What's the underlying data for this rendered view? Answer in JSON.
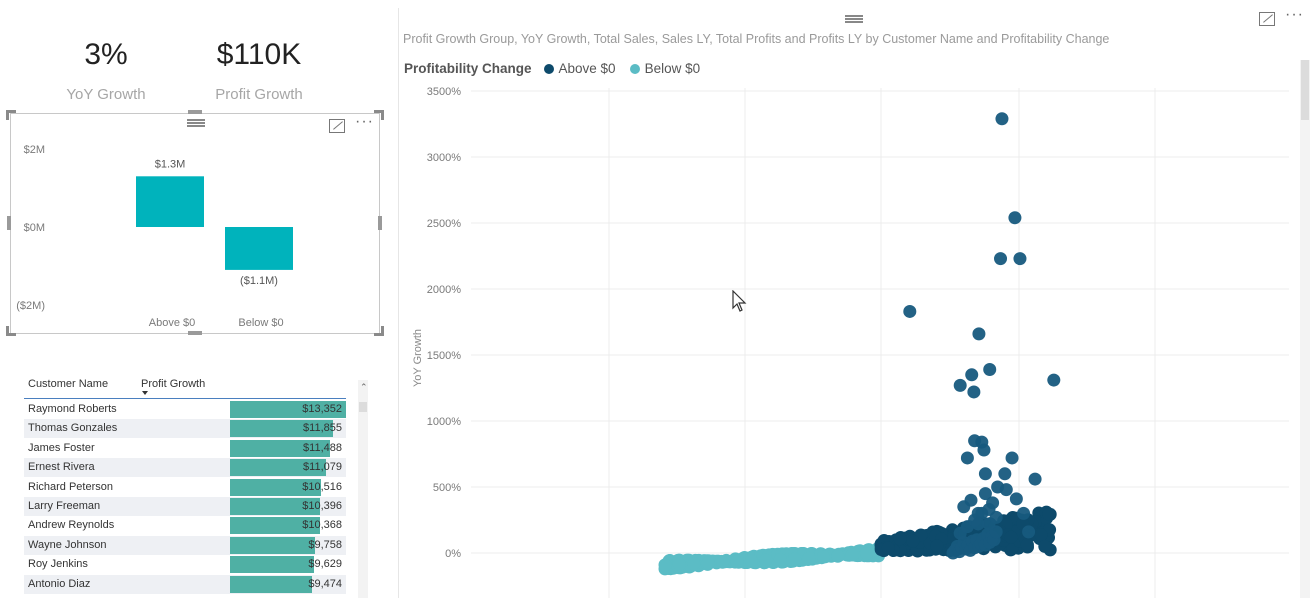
{
  "kpis": [
    {
      "value": "3%",
      "label": "YoY Growth"
    },
    {
      "value": "$110K",
      "label": "Profit Growth"
    }
  ],
  "bar_chart": {
    "y_ticks": [
      "$2M",
      "$0M",
      "($2M)"
    ],
    "categories": [
      "Above $0",
      "Below $0"
    ],
    "data_labels": [
      "$1.3M",
      "($1.1M)"
    ],
    "values": [
      1.3,
      -1.1
    ],
    "color": "#00b3bc"
  },
  "table": {
    "headers": [
      "Customer Name",
      "Profit Growth"
    ],
    "sort_icon": "sort-desc-icon",
    "bar_color": "#4fb0a4",
    "max": 13352,
    "rows": [
      {
        "name": "Raymond Roberts",
        "amount": "$13,352",
        "value": 13352
      },
      {
        "name": "Thomas Gonzales",
        "amount": "$11,855",
        "value": 11855
      },
      {
        "name": "James Foster",
        "amount": "$11,488",
        "value": 11488
      },
      {
        "name": "Ernest Rivera",
        "amount": "$11,079",
        "value": 11079
      },
      {
        "name": "Richard Peterson",
        "amount": "$10,516",
        "value": 10516
      },
      {
        "name": "Larry Freeman",
        "amount": "$10,396",
        "value": 10396
      },
      {
        "name": "Andrew Reynolds",
        "amount": "$10,368",
        "value": 10368
      },
      {
        "name": "Wayne Johnson",
        "amount": "$9,758",
        "value": 9758
      },
      {
        "name": "Roy Jenkins",
        "amount": "$9,629",
        "value": 9629
      },
      {
        "name": "Antonio Diaz",
        "amount": "$9,474",
        "value": 9474
      }
    ]
  },
  "scatter": {
    "title": "Profit Growth Group, YoY Growth, Total Sales, Sales LY, Total Profits and Profits LY by Customer Name and Profitability Change",
    "legend_title": "Profitability Change",
    "legend": [
      {
        "name": "Above $0",
        "color": "#0d4a6b"
      },
      {
        "name": "Below $0",
        "color": "#5bbcc5"
      }
    ]
  },
  "chart_data": {
    "type": "scatter",
    "title": "Profit Growth Group, YoY Growth, Total Sales, Sales LY, Total Profits and Profits LY by Customer Name and Profitability Change",
    "xlabel": "",
    "ylabel": "YoY Growth",
    "y_ticks": [
      "3500%",
      "3000%",
      "2500%",
      "2000%",
      "1500%",
      "1000%",
      "500%",
      "0%"
    ],
    "ylim": [
      -100,
      3500
    ],
    "grid": true,
    "legend_position": "top-left",
    "series": [
      {
        "name": "Above $0",
        "x": [
          1.0,
          1.03,
          1.06,
          1.09,
          1.12,
          1.15,
          1.18,
          1.21,
          1.24,
          1.27,
          1.3,
          1.33,
          1.36,
          1.39,
          1.42,
          1.45,
          1.48,
          1.51,
          1.54,
          1.57,
          1.6,
          1.1,
          1.2,
          1.3,
          1.4,
          1.5,
          1.15,
          1.25,
          1.35,
          1.45,
          1.55,
          1.62,
          1.72,
          0.4,
          1.68,
          1.86,
          1.93,
          1.66,
          1.36,
          1.51,
          1.26,
          1.1,
          1.29,
          1.4,
          1.3,
          1.43,
          1.2,
          1.45,
          2.4,
          2.14,
          1.82,
          1.74,
          1.88,
          1.98,
          2.05,
          1.6,
          1.5,
          1.35
        ],
        "y": [
          0,
          20,
          50,
          10,
          40,
          80,
          30,
          60,
          20,
          90,
          40,
          100,
          50,
          70,
          110,
          60,
          140,
          80,
          120,
          100,
          160,
          150,
          200,
          250,
          300,
          220,
          350,
          400,
          300,
          450,
          380,
          500,
          600,
          1830,
          3290,
          2540,
          2230,
          2230,
          1660,
          1390,
          1350,
          1270,
          1220,
          840,
          850,
          780,
          720,
          600,
          1310,
          560,
          720,
          480,
          410,
          300,
          160,
          270,
          330,
          220
        ]
      },
      {
        "name": "Below $0",
        "x": [
          -3.0,
          -2.8,
          -2.6,
          -2.4,
          -2.2,
          -2.0,
          -1.8,
          -1.6,
          -1.4,
          -1.2,
          -1.0,
          -0.8,
          -0.6,
          -0.4,
          -0.2,
          -0.05
        ],
        "y": [
          -90,
          -85,
          -80,
          -75,
          -70,
          -65,
          -60,
          -55,
          -50,
          -45,
          -40,
          -30,
          -25,
          -15,
          -5,
          10
        ]
      }
    ]
  },
  "icons": [
    "drag-handle-icon",
    "focus-mode-icon",
    "more-options-icon",
    "mouse-cursor-icon"
  ]
}
